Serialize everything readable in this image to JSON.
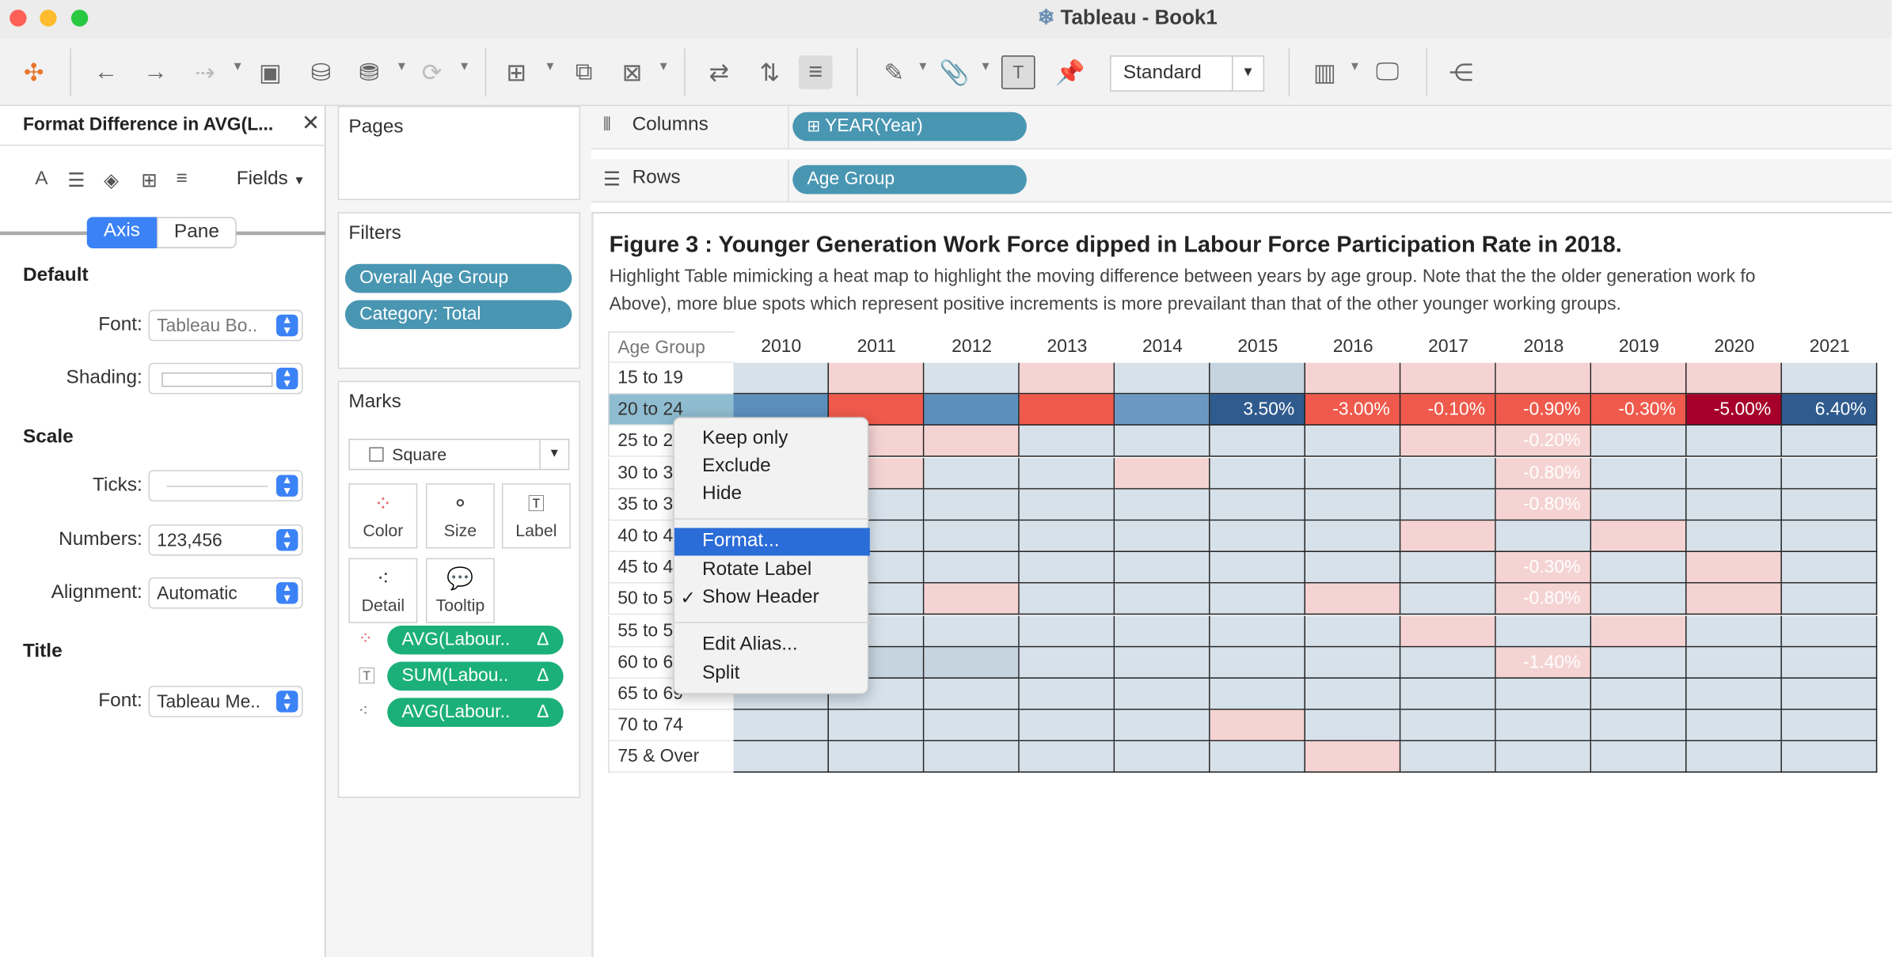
{
  "window": {
    "title": "Tableau - Book1"
  },
  "toolbar": {
    "view_mode": "Standard"
  },
  "format_panel": {
    "title": "Format Difference in AVG(L...",
    "fields_label": "Fields",
    "tabs": [
      "Axis",
      "Pane"
    ],
    "active_tab": "Axis",
    "default": {
      "header": "Default",
      "font_label": "Font:",
      "font_value": "Tableau Bo..",
      "shading_label": "Shading:"
    },
    "scale": {
      "header": "Scale",
      "ticks_label": "Ticks:",
      "numbers_label": "Numbers:",
      "numbers_value": "123,456",
      "alignment_label": "Alignment:",
      "alignment_value": "Automatic"
    },
    "title_section": {
      "header": "Title",
      "font_label": "Font:",
      "font_value": "Tableau Me.."
    }
  },
  "pages": {
    "label": "Pages"
  },
  "filters": {
    "label": "Filters",
    "items": [
      "Overall Age Group",
      "Category: Total"
    ]
  },
  "marks": {
    "label": "Marks",
    "type": "Square",
    "buttons": [
      "Color",
      "Size",
      "Label",
      "Detail",
      "Tooltip"
    ],
    "pills": [
      "AVG(Labour..",
      "SUM(Labou..",
      "AVG(Labour.."
    ],
    "delta": "Δ"
  },
  "shelves": {
    "columns_label": "Columns",
    "columns_pill": "YEAR(Year)",
    "rows_label": "Rows",
    "rows_pill": "Age Group"
  },
  "viz": {
    "title": "Figure 3 : Younger Generation Work Force dipped in Labour Force Participation Rate in 2018.",
    "subtitle_line1": "Highlight Table mimicking a heat map to highlight the moving difference between years by age group. Note that the the older generation work fo",
    "subtitle_line2": "Above), more blue spots which represent positive increments is more  prevailant than that of the other younger working groups.",
    "row_header": "Age Group",
    "years": [
      "2010",
      "2011",
      "2012",
      "2013",
      "2014",
      "2015",
      "2016",
      "2017",
      "2018",
      "2019",
      "2020",
      "2021"
    ],
    "age_groups": [
      "15 to 19",
      "20 to 24",
      "25 to 29",
      "30 to 34",
      "35 to 39",
      "40 to 44",
      "45 to 49",
      "50 to 54",
      "55 to 59",
      "60 to 64",
      "65 to 69",
      "70 to 74",
      "75 & Over"
    ],
    "highlighted_row": "20 to 24",
    "cell_colors": {
      "15 to 19": [
        "#d6e1ea",
        "#f5d3d3",
        "#d6e1ea",
        "#f5d3d3",
        "#d6e1ea",
        "#c6d4e0",
        "#f5d3d3",
        "#f5d3d3",
        "#f5d3d3",
        "#f5d3d3",
        "#f5d3d3",
        "#d6e1ea"
      ],
      "20 to 24": [
        "#5d8fbd",
        "#ef5a4c",
        "#5d8fbd",
        "#ef5a4c",
        "#6a98c2",
        "#2f5b8e",
        "#ef5a4c",
        "#ef5a4c",
        "#ef5a4c",
        "#ef5a4c",
        "#a6002a",
        "#2f5b8e"
      ],
      "25 to 29": [
        "#d6e1ea",
        "#f5d3d3",
        "#f5d3d3",
        "#d6e1ea",
        "#d6e1ea",
        "#d6e1ea",
        "#d6e1ea",
        "#f5d3d3",
        "#f5d3d3",
        "#d6e1ea",
        "#d6e1ea",
        "#d6e1ea"
      ],
      "30 to 34": [
        "#d6e1ea",
        "#f5d3d3",
        "#d6e1ea",
        "#d6e1ea",
        "#f5d3d3",
        "#d6e1ea",
        "#d6e1ea",
        "#d6e1ea",
        "#f5d3d3",
        "#d6e1ea",
        "#d6e1ea",
        "#d6e1ea"
      ],
      "35 to 39": [
        "#d6e1ea",
        "#d6e1ea",
        "#d6e1ea",
        "#d6e1ea",
        "#d6e1ea",
        "#d6e1ea",
        "#d6e1ea",
        "#d6e1ea",
        "#f5d3d3",
        "#d6e1ea",
        "#d6e1ea",
        "#d6e1ea"
      ],
      "40 to 44": [
        "#d6e1ea",
        "#d6e1ea",
        "#d6e1ea",
        "#d6e1ea",
        "#d6e1ea",
        "#d6e1ea",
        "#d6e1ea",
        "#f5d3d3",
        "#d6e1ea",
        "#f5d3d3",
        "#d6e1ea",
        "#d6e1ea"
      ],
      "45 to 49": [
        "#d6e1ea",
        "#d6e1ea",
        "#d6e1ea",
        "#d6e1ea",
        "#d6e1ea",
        "#d6e1ea",
        "#d6e1ea",
        "#d6e1ea",
        "#f5d3d3",
        "#d6e1ea",
        "#f5d3d3",
        "#d6e1ea"
      ],
      "50 to 54": [
        "#d6e1ea",
        "#d6e1ea",
        "#f5d3d3",
        "#d6e1ea",
        "#d6e1ea",
        "#d6e1ea",
        "#f5d3d3",
        "#d6e1ea",
        "#f5d3d3",
        "#d6e1ea",
        "#f5d3d3",
        "#d6e1ea"
      ],
      "55 to 59": [
        "#d6e1ea",
        "#d6e1ea",
        "#d6e1ea",
        "#d6e1ea",
        "#d6e1ea",
        "#d6e1ea",
        "#d6e1ea",
        "#f5d3d3",
        "#d6e1ea",
        "#f5d3d3",
        "#d6e1ea",
        "#d6e1ea"
      ],
      "60 to 64": [
        "#d6e1ea",
        "#c6d4e0",
        "#c6d4e0",
        "#d6e1ea",
        "#d6e1ea",
        "#d6e1ea",
        "#d6e1ea",
        "#d6e1ea",
        "#f5d3d3",
        "#d6e1ea",
        "#d6e1ea",
        "#d6e1ea"
      ],
      "65 to 69": [
        "#d6e1ea",
        "#d6e1ea",
        "#d6e1ea",
        "#d6e1ea",
        "#d6e1ea",
        "#d6e1ea",
        "#d6e1ea",
        "#d6e1ea",
        "#d6e1ea",
        "#d6e1ea",
        "#d6e1ea",
        "#d6e1ea"
      ],
      "70 to 74": [
        "#d6e1ea",
        "#d6e1ea",
        "#d6e1ea",
        "#d6e1ea",
        "#d6e1ea",
        "#f5d3d3",
        "#d6e1ea",
        "#d6e1ea",
        "#d6e1ea",
        "#d6e1ea",
        "#d6e1ea",
        "#d6e1ea"
      ],
      "75 & Over": [
        "#d6e1ea",
        "#d6e1ea",
        "#d6e1ea",
        "#d6e1ea",
        "#d6e1ea",
        "#d6e1ea",
        "#f5d3d3",
        "#d6e1ea",
        "#d6e1ea",
        "#d6e1ea",
        "#d6e1ea",
        "#d6e1ea"
      ]
    },
    "cell_labels": {
      "20 to 24": {
        "2015": "3.50%",
        "2016": "-3.00%",
        "2017": "-0.10%",
        "2018": "-0.90%",
        "2019": "-0.30%",
        "2020": "-5.00%",
        "2021": "6.40%"
      },
      "25 to 29": {
        "2018": "-0.20%"
      },
      "30 to 34": {
        "2018": "-0.80%"
      },
      "35 to 39": {
        "2018": "-0.80%"
      },
      "45 to 49": {
        "2018": "-0.30%"
      },
      "50 to 54": {
        "2018": "-0.80%"
      },
      "60 to 64": {
        "2018": "-1.40%"
      }
    }
  },
  "context_menu": {
    "items": [
      "Keep only",
      "Exclude",
      "Hide",
      "Format...",
      "Rotate Label",
      "Show Header",
      "Edit Alias...",
      "Split"
    ],
    "highlighted": "Format...",
    "checked": "Show Header",
    "check_mark": "✓"
  }
}
